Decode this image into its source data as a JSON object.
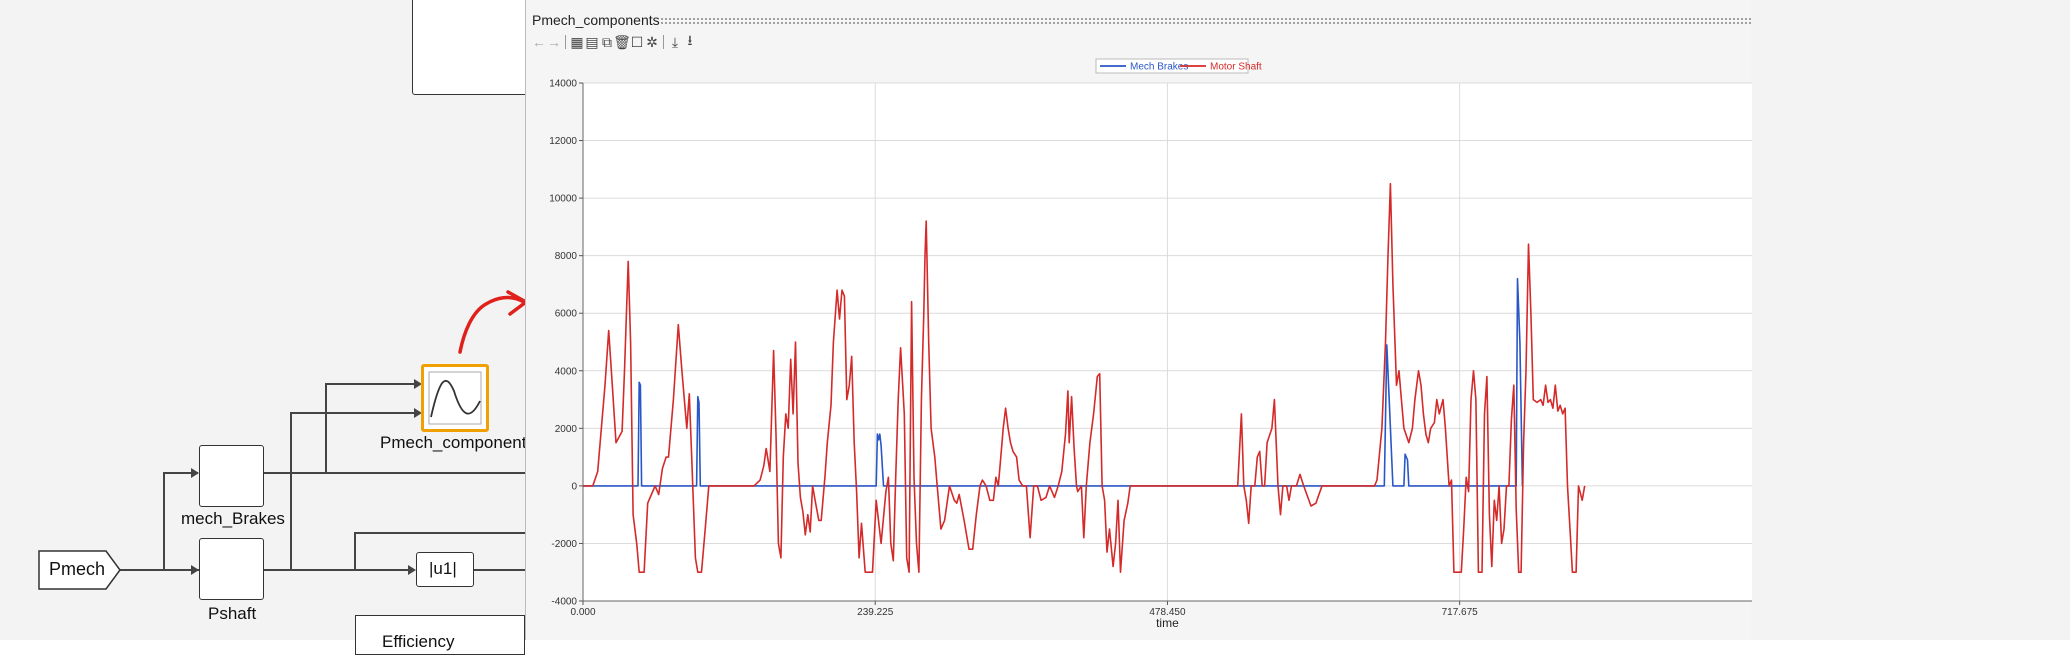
{
  "diagram": {
    "blocks": {
      "pmech_from": "Pmech",
      "mech_brakes": "mech_Brakes",
      "pshaft": "Pshaft",
      "abs": "|u1|",
      "scope": "Pmech_components",
      "efficiency": "Efficiency"
    }
  },
  "scope": {
    "title": "Pmech_components",
    "toolbar": [
      "back-arrow-icon",
      "forward-arrow-icon",
      "table-icon",
      "chart-icon",
      "copy-icon",
      "delete-icon",
      "frame-icon",
      "settings-icon",
      "download-icon",
      "save-icon"
    ]
  },
  "chart_data": {
    "type": "line",
    "xlabel": "time",
    "ylabel": "",
    "x_ticks": [
      "0.000",
      "239.225",
      "478.450",
      "717.675"
    ],
    "y_ticks": [
      "-4000",
      "-2000",
      "0",
      "2000",
      "4000",
      "6000",
      "8000",
      "10000",
      "12000",
      "14000"
    ],
    "xlim": [
      0,
      957
    ],
    "ylim": [
      -4000,
      14000
    ],
    "grid": true,
    "legend_position": "top-center",
    "colors": {
      "mech_brakes": "#2a57c6",
      "motor_shaft": "#d42a2a"
    },
    "series": [
      {
        "name": "Mech Brakes",
        "points": [
          [
            0,
            0
          ],
          [
            45,
            0
          ],
          [
            46,
            3600
          ],
          [
            47,
            3500
          ],
          [
            48,
            0
          ],
          [
            93,
            0
          ],
          [
            94,
            3100
          ],
          [
            95,
            2900
          ],
          [
            96,
            0
          ],
          [
            240,
            0
          ],
          [
            241,
            1800
          ],
          [
            242,
            1600
          ],
          [
            243,
            1800
          ],
          [
            244,
            1400
          ],
          [
            246,
            0
          ],
          [
            656,
            0
          ],
          [
            658,
            4900
          ],
          [
            660,
            3000
          ],
          [
            663,
            0
          ],
          [
            672,
            0
          ],
          [
            673,
            1100
          ],
          [
            675,
            900
          ],
          [
            676,
            0
          ],
          [
            764,
            0
          ],
          [
            765,
            7200
          ],
          [
            767,
            5000
          ],
          [
            769,
            0
          ]
        ]
      },
      {
        "name": "Motor Shaft",
        "points": [
          [
            0,
            0
          ],
          [
            8,
            0
          ],
          [
            12,
            500
          ],
          [
            18,
            3500
          ],
          [
            21,
            5400
          ],
          [
            24,
            3500
          ],
          [
            27,
            1500
          ],
          [
            32,
            1900
          ],
          [
            34,
            4000
          ],
          [
            37,
            7800
          ],
          [
            39,
            5000
          ],
          [
            41,
            -1000
          ],
          [
            44,
            -2000
          ],
          [
            46,
            -3000
          ],
          [
            50,
            -3000
          ],
          [
            53,
            -600
          ],
          [
            56,
            -300
          ],
          [
            59,
            0
          ],
          [
            62,
            -300
          ],
          [
            65,
            600
          ],
          [
            68,
            1000
          ],
          [
            70,
            1000
          ],
          [
            74,
            3000
          ],
          [
            78,
            5600
          ],
          [
            81,
            4000
          ],
          [
            85,
            2000
          ],
          [
            87,
            3200
          ],
          [
            89,
            1000
          ],
          [
            92,
            -2500
          ],
          [
            94,
            -3000
          ],
          [
            97,
            -3000
          ],
          [
            100,
            -1500
          ],
          [
            103,
            0
          ],
          [
            110,
            0
          ],
          [
            140,
            0
          ],
          [
            145,
            200
          ],
          [
            148,
            700
          ],
          [
            150,
            1300
          ],
          [
            153,
            500
          ],
          [
            156,
            4700
          ],
          [
            158,
            1800
          ],
          [
            160,
            -2000
          ],
          [
            162,
            -2500
          ],
          [
            164,
            1000
          ],
          [
            166,
            2500
          ],
          [
            168,
            2000
          ],
          [
            170,
            4400
          ],
          [
            172,
            2500
          ],
          [
            174,
            5000
          ],
          [
            176,
            800
          ],
          [
            178,
            -400
          ],
          [
            180,
            -900
          ],
          [
            182,
            -1700
          ],
          [
            184,
            -1000
          ],
          [
            186,
            -1600
          ],
          [
            188,
            0
          ],
          [
            190,
            -500
          ],
          [
            193,
            -1200
          ],
          [
            195,
            -1200
          ],
          [
            198,
            300
          ],
          [
            200,
            1500
          ],
          [
            203,
            2800
          ],
          [
            205,
            5000
          ],
          [
            208,
            6800
          ],
          [
            210,
            5800
          ],
          [
            212,
            6800
          ],
          [
            214,
            6600
          ],
          [
            216,
            3000
          ],
          [
            218,
            3500
          ],
          [
            220,
            4500
          ],
          [
            222,
            1500
          ],
          [
            224,
            -200
          ],
          [
            226,
            -2500
          ],
          [
            228,
            -1300
          ],
          [
            231,
            -3000
          ],
          [
            237,
            -3000
          ],
          [
            240,
            -500
          ],
          [
            244,
            -2000
          ],
          [
            248,
            -200
          ],
          [
            250,
            300
          ],
          [
            252,
            -2000
          ],
          [
            254,
            -2600
          ],
          [
            256,
            300
          ],
          [
            258,
            3000
          ],
          [
            260,
            4800
          ],
          [
            263,
            2500
          ],
          [
            265,
            -2500
          ],
          [
            267,
            -3000
          ],
          [
            269,
            6400
          ],
          [
            271,
            300
          ],
          [
            273,
            -2000
          ],
          [
            275,
            -3000
          ],
          [
            277,
            3000
          ],
          [
            279,
            6000
          ],
          [
            280,
            8000
          ],
          [
            281,
            9200
          ],
          [
            283,
            5000
          ],
          [
            285,
            2000
          ],
          [
            288,
            1000
          ],
          [
            290,
            0
          ],
          [
            293,
            -1500
          ],
          [
            296,
            -1200
          ],
          [
            300,
            0
          ],
          [
            304,
            -500
          ],
          [
            306,
            -600
          ],
          [
            308,
            -300
          ],
          [
            312,
            -1200
          ],
          [
            316,
            -2200
          ],
          [
            319,
            -2200
          ],
          [
            322,
            -1000
          ],
          [
            325,
            0
          ],
          [
            327,
            200
          ],
          [
            330,
            0
          ],
          [
            333,
            -500
          ],
          [
            336,
            -500
          ],
          [
            338,
            300
          ],
          [
            340,
            0
          ],
          [
            342,
            1000
          ],
          [
            344,
            2000
          ],
          [
            346,
            2700
          ],
          [
            348,
            2000
          ],
          [
            350,
            1500
          ],
          [
            352,
            1200
          ],
          [
            355,
            1000
          ],
          [
            357,
            200
          ],
          [
            360,
            0
          ],
          [
            363,
            0
          ],
          [
            366,
            -1800
          ],
          [
            369,
            0
          ],
          [
            372,
            0
          ],
          [
            375,
            -500
          ],
          [
            379,
            -400
          ],
          [
            382,
            0
          ],
          [
            386,
            -400
          ],
          [
            389,
            0
          ],
          [
            392,
            500
          ],
          [
            395,
            1800
          ],
          [
            397,
            3300
          ],
          [
            398,
            1500
          ],
          [
            400,
            3100
          ],
          [
            402,
            1300
          ],
          [
            404,
            0
          ],
          [
            405,
            -200
          ],
          [
            408,
            0
          ],
          [
            410,
            -1800
          ],
          [
            412,
            0
          ],
          [
            415,
            1500
          ],
          [
            418,
            2500
          ],
          [
            421,
            3800
          ],
          [
            423,
            3900
          ],
          [
            425,
            0
          ],
          [
            427,
            -500
          ],
          [
            429,
            -2300
          ],
          [
            431,
            -1500
          ],
          [
            434,
            -2800
          ],
          [
            436,
            -2000
          ],
          [
            438,
            -500
          ],
          [
            440,
            -3000
          ],
          [
            443,
            -1200
          ],
          [
            446,
            -600
          ],
          [
            448,
            0
          ],
          [
            460,
            0
          ],
          [
            500,
            0
          ],
          [
            536,
            0
          ],
          [
            539,
            2500
          ],
          [
            541,
            0
          ],
          [
            543,
            -500
          ],
          [
            545,
            -1300
          ],
          [
            547,
            0
          ],
          [
            550,
            0
          ],
          [
            552,
            1000
          ],
          [
            554,
            1200
          ],
          [
            556,
            0
          ],
          [
            558,
            0
          ],
          [
            560,
            1500
          ],
          [
            564,
            2000
          ],
          [
            566,
            3000
          ],
          [
            568,
            1000
          ],
          [
            569,
            0
          ],
          [
            571,
            -1000
          ],
          [
            573,
            0
          ],
          [
            576,
            0
          ],
          [
            578,
            -500
          ],
          [
            580,
            0
          ],
          [
            584,
            0
          ],
          [
            587,
            400
          ],
          [
            590,
            0
          ],
          [
            596,
            -700
          ],
          [
            600,
            -600
          ],
          [
            605,
            0
          ],
          [
            640,
            0
          ],
          [
            648,
            0
          ],
          [
            650,
            200
          ],
          [
            654,
            2000
          ],
          [
            657,
            5000
          ],
          [
            659,
            8000
          ],
          [
            661,
            10500
          ],
          [
            663,
            7000
          ],
          [
            666,
            3500
          ],
          [
            668,
            4000
          ],
          [
            670,
            3000
          ],
          [
            672,
            2000
          ],
          [
            676,
            1500
          ],
          [
            679,
            2000
          ],
          [
            681,
            3000
          ],
          [
            684,
            4000
          ],
          [
            686,
            3500
          ],
          [
            688,
            2500
          ],
          [
            690,
            1800
          ],
          [
            692,
            1500
          ],
          [
            694,
            2000
          ],
          [
            697,
            2200
          ],
          [
            699,
            3000
          ],
          [
            701,
            2500
          ],
          [
            704,
            3000
          ],
          [
            706,
            2000
          ],
          [
            709,
            0
          ],
          [
            711,
            200
          ],
          [
            713,
            -3000
          ],
          [
            719,
            -3000
          ],
          [
            721,
            -1500
          ],
          [
            723,
            300
          ],
          [
            725,
            -200
          ],
          [
            727,
            3000
          ],
          [
            729,
            4000
          ],
          [
            731,
            3000
          ],
          [
            733,
            -3000
          ],
          [
            736,
            -3000
          ],
          [
            738,
            2500
          ],
          [
            740,
            3800
          ],
          [
            742,
            -1000
          ],
          [
            744,
            -2800
          ],
          [
            746,
            -500
          ],
          [
            748,
            -1200
          ],
          [
            750,
            0
          ],
          [
            752,
            -2000
          ],
          [
            754,
            -1500
          ],
          [
            756,
            0
          ],
          [
            758,
            0
          ],
          [
            760,
            2300
          ],
          [
            762,
            3500
          ],
          [
            764,
            -800
          ],
          [
            766,
            -3000
          ],
          [
            768,
            -3000
          ],
          [
            770,
            1500
          ],
          [
            772,
            4000
          ],
          [
            774,
            8400
          ],
          [
            776,
            6000
          ],
          [
            778,
            3000
          ],
          [
            781,
            2900
          ],
          [
            784,
            3000
          ],
          [
            786,
            2800
          ],
          [
            788,
            3500
          ],
          [
            790,
            2900
          ],
          [
            792,
            3000
          ],
          [
            794,
            2700
          ],
          [
            796,
            3500
          ],
          [
            798,
            2600
          ],
          [
            800,
            2800
          ],
          [
            802,
            2500
          ],
          [
            804,
            2700
          ],
          [
            806,
            0
          ],
          [
            808,
            -1500
          ],
          [
            810,
            -3000
          ],
          [
            813,
            -3000
          ],
          [
            815,
            0
          ],
          [
            818,
            -500
          ],
          [
            820,
            0
          ]
        ]
      }
    ]
  }
}
